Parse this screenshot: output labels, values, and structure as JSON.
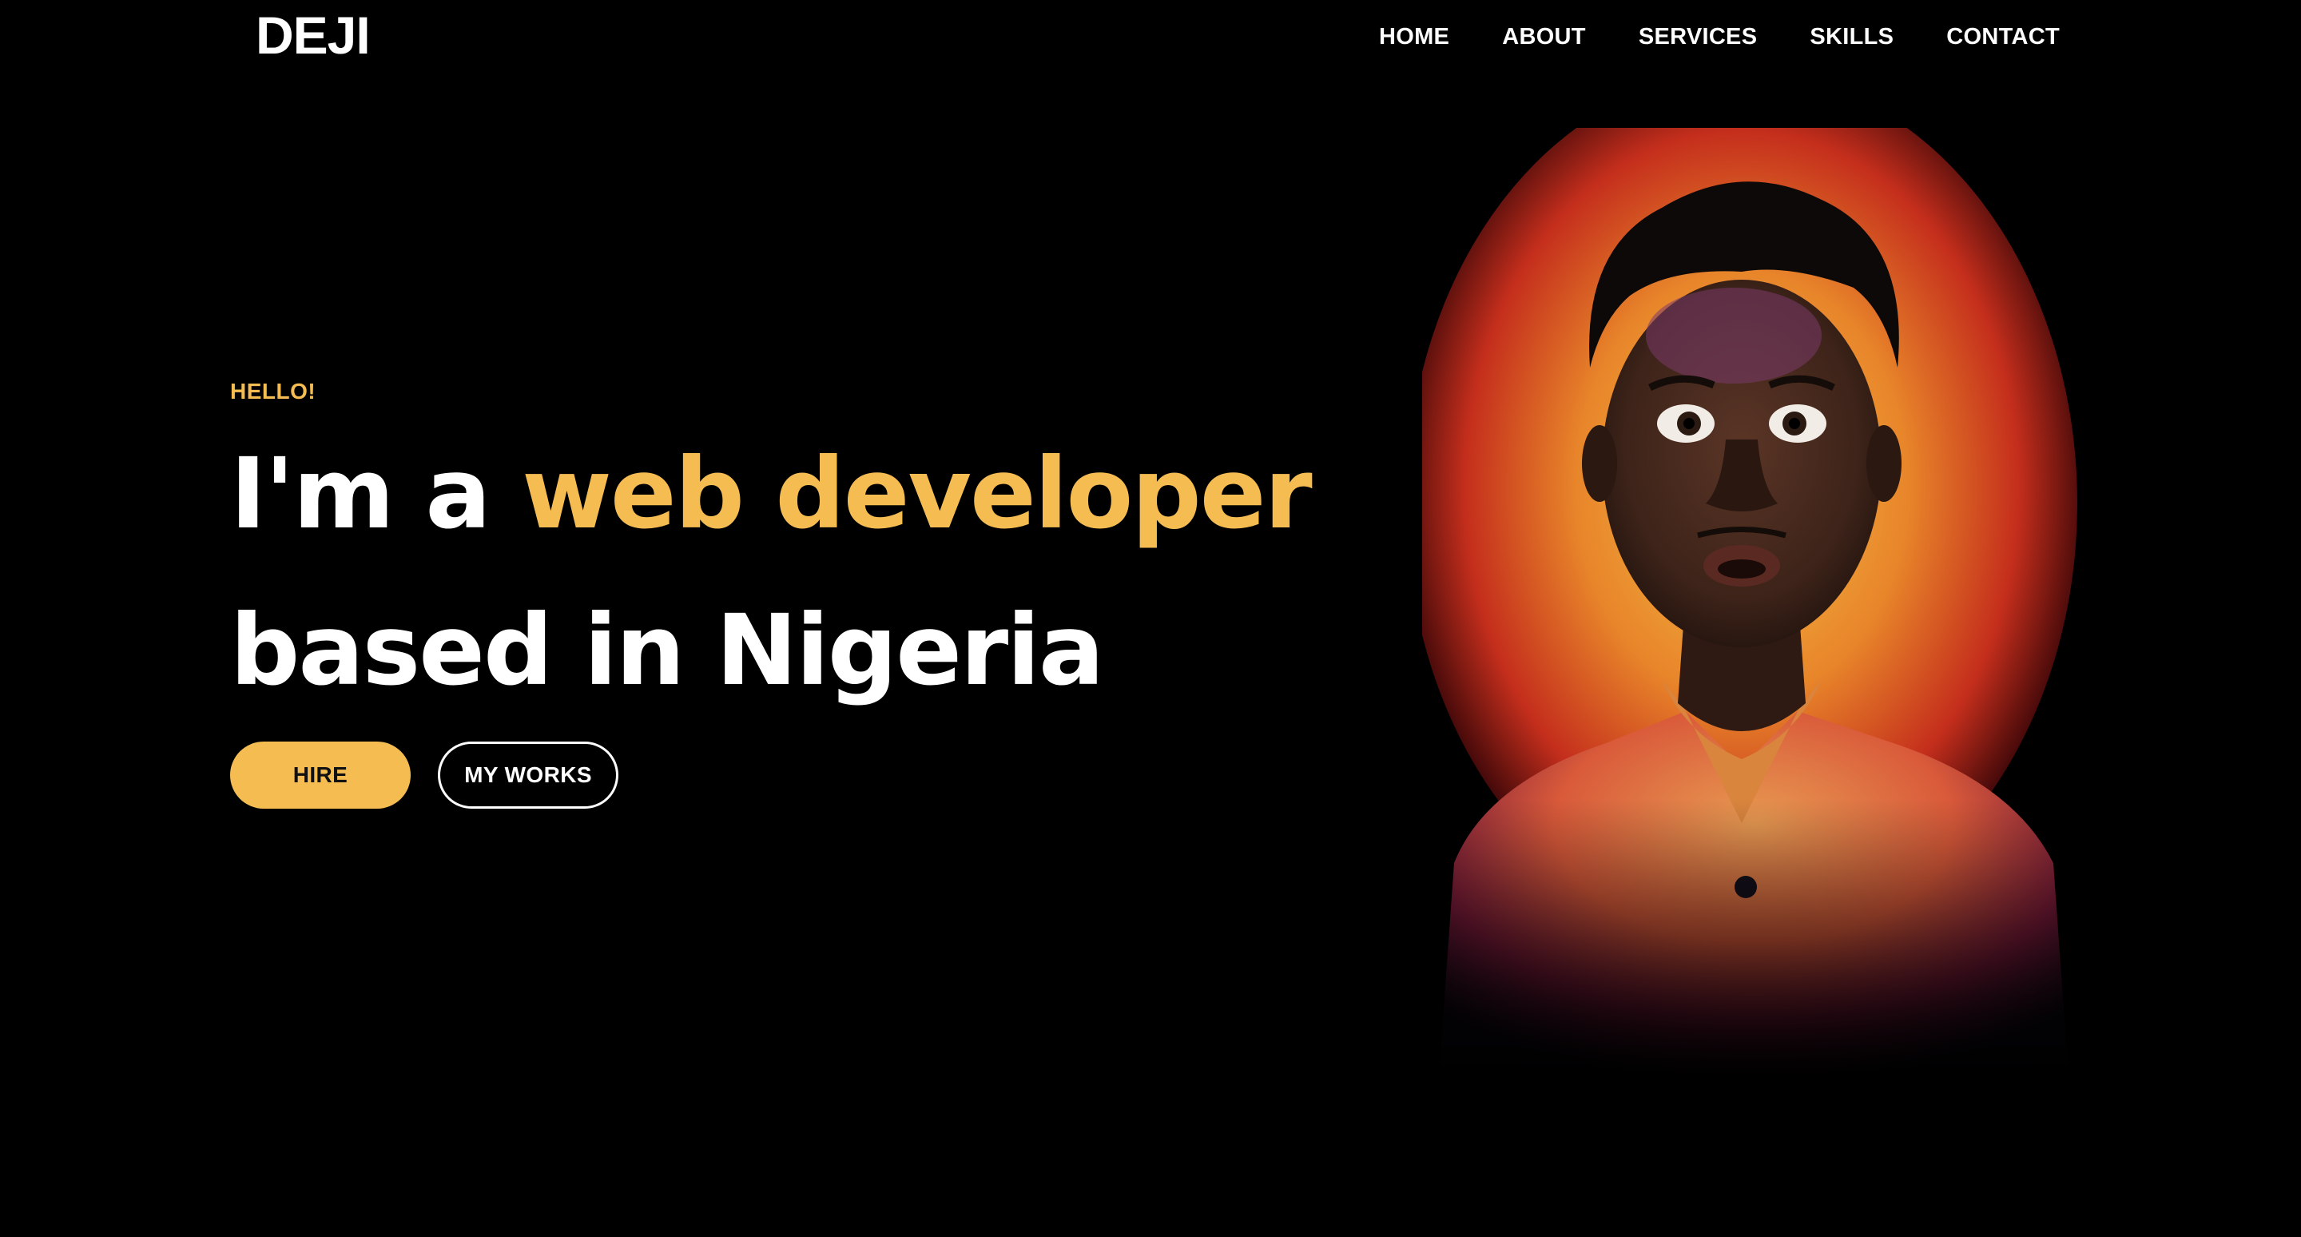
{
  "brand": {
    "logo": "DEJI"
  },
  "nav": {
    "items": [
      {
        "label": "HOME"
      },
      {
        "label": "ABOUT"
      },
      {
        "label": "SERVICES"
      },
      {
        "label": "SKILLS"
      },
      {
        "label": "CONTACT"
      }
    ]
  },
  "hero": {
    "eyebrow": "HELLO!",
    "line1_prefix": "I'm a ",
    "line1_accent": "web developer",
    "line2": "based in Nigeria",
    "hire_label": "HIRE",
    "works_label": "MY WORKS"
  },
  "colors": {
    "accent": "#f5bc52",
    "background": "#000000",
    "text": "#ffffff"
  },
  "icons": {
    "portrait": "portrait-photo"
  }
}
